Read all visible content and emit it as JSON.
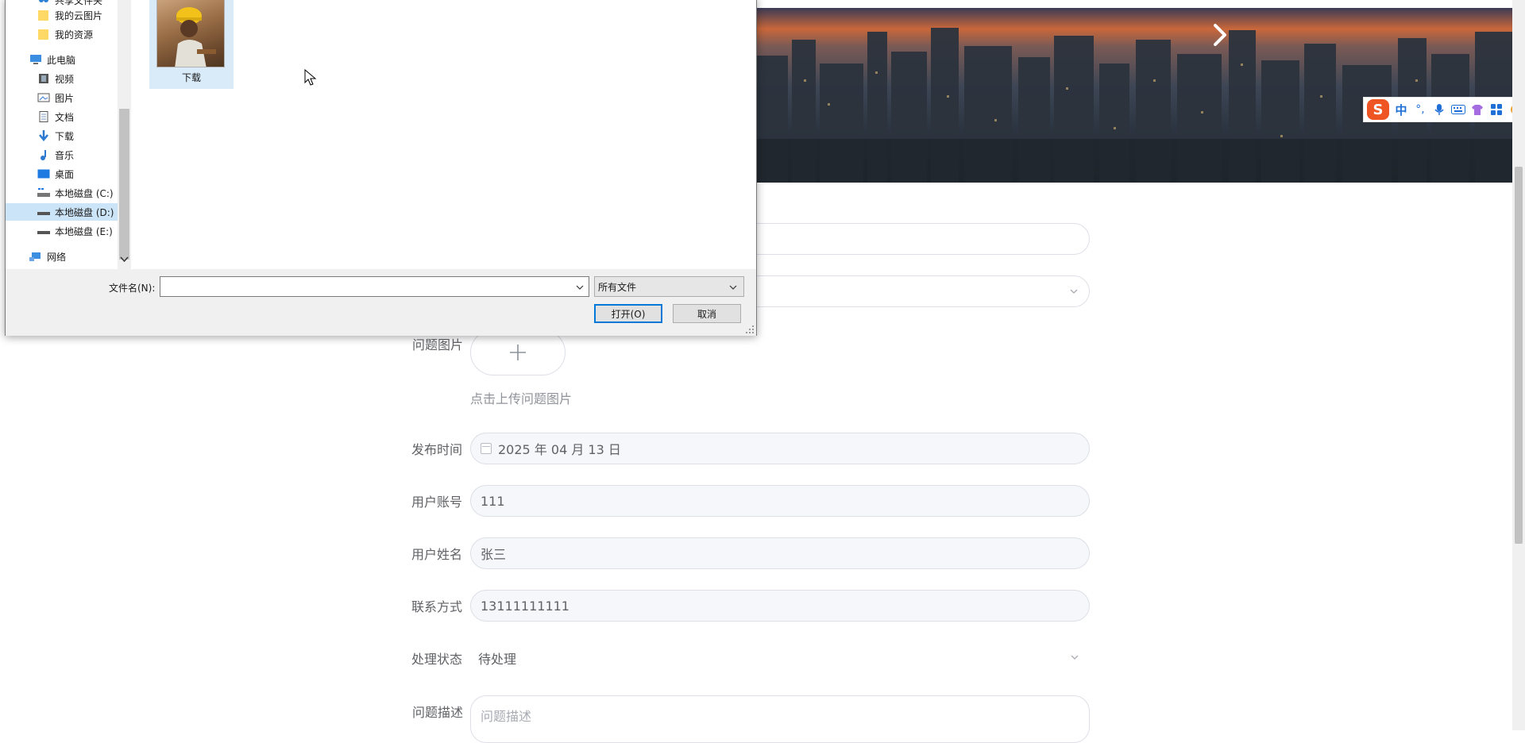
{
  "dialog": {
    "nav_items": [
      {
        "label": "共享文件夹",
        "icon": "shared-folder-icon"
      },
      {
        "label": "我的云图片",
        "icon": "folder-icon"
      },
      {
        "label": "我的资源",
        "icon": "folder-icon"
      },
      {
        "label": "此电脑",
        "icon": "computer-icon"
      },
      {
        "label": "视频",
        "icon": "video-icon"
      },
      {
        "label": "图片",
        "icon": "pictures-icon"
      },
      {
        "label": "文档",
        "icon": "documents-icon"
      },
      {
        "label": "下载",
        "icon": "download-icon"
      },
      {
        "label": "音乐",
        "icon": "music-icon"
      },
      {
        "label": "桌面",
        "icon": "desktop-icon"
      },
      {
        "label": "本地磁盘 (C:)",
        "icon": "drive-c-icon"
      },
      {
        "label": "本地磁盘 (D:)",
        "icon": "drive-icon"
      },
      {
        "label": "本地磁盘 (E:)",
        "icon": "drive-icon"
      },
      {
        "label": "网络",
        "icon": "network-icon"
      }
    ],
    "file": {
      "name": "下载"
    },
    "filename_label": "文件名(N):",
    "filename_value": "",
    "filetype_value": "所有文件",
    "open_label": "打开(O)",
    "cancel_label": "取消"
  },
  "form": {
    "upload_label": "问题图片",
    "upload_hint": "点击上传问题图片",
    "publish_time_label": "发布时间",
    "publish_time_value": "2025 年 04 月 13 日",
    "account_label": "用户账号",
    "account_value": "111",
    "name_label": "用户姓名",
    "name_value": "张三",
    "contact_label": "联系方式",
    "contact_value": "13111111111",
    "status_label": "处理状态",
    "status_value": "待处理",
    "description_label": "问题描述",
    "description_placeholder": "问题描述"
  },
  "ime": {
    "logo": "S",
    "lang": "中",
    "punct": "°,"
  },
  "colors": {
    "accent": "#0078d7",
    "selected_bg": "#cce4f7",
    "ime_blue": "#1f6fd6",
    "ime_logo": "#ee5522"
  }
}
